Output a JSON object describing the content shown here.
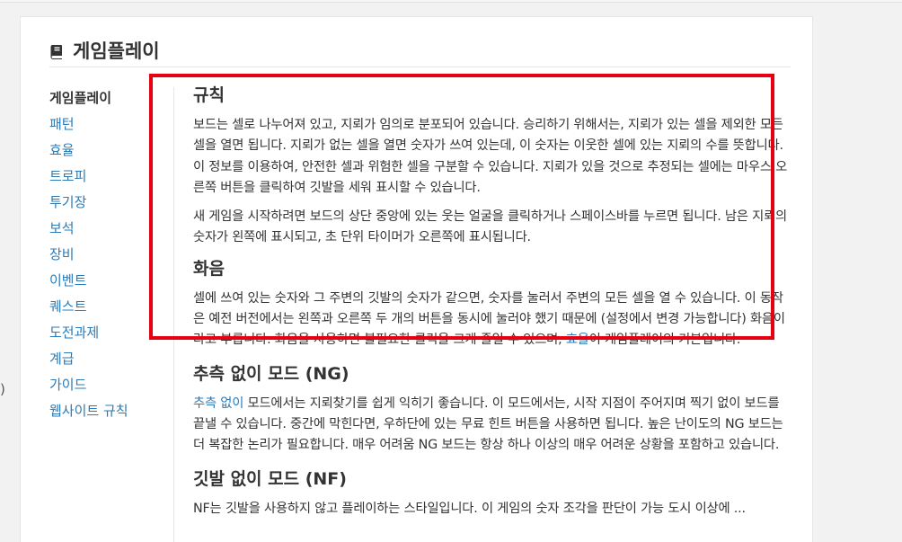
{
  "left_stub_text": ")",
  "page": {
    "title": "게임플레이",
    "icon": "book-icon"
  },
  "sidebar": {
    "items": [
      {
        "label": "게임플레이",
        "active": true
      },
      {
        "label": "패턴"
      },
      {
        "label": "효율"
      },
      {
        "label": "트로피"
      },
      {
        "label": "투기장"
      },
      {
        "label": "보석"
      },
      {
        "label": "장비"
      },
      {
        "label": "이벤트"
      },
      {
        "label": "퀘스트"
      },
      {
        "label": "도전과제"
      },
      {
        "label": "계급"
      },
      {
        "label": "가이드"
      },
      {
        "label": "웹사이트 규칙"
      }
    ]
  },
  "content": {
    "rules": {
      "heading": "규칙",
      "p1": "보드는 셀로 나누어져 있고, 지뢰가 임의로 분포되어 있습니다. 승리하기 위해서는, 지뢰가 있는 셀을 제외한 모든 셀을 열면 됩니다. 지뢰가 없는 셀을 열면 숫자가 쓰여 있는데, 이 숫자는 이웃한 셀에 있는 지뢰의 수를 뜻합니다. 이 정보를 이용하여, 안전한 셀과 위험한 셀을 구분할 수 있습니다. 지뢰가 있을 것으로 추정되는 셀에는 마우스 오른쪽 버튼을 클릭하여 깃발을 세워 표시할 수 있습니다.",
      "p2": "새 게임을 시작하려면 보드의 상단 중앙에 있는 웃는 얼굴을 클릭하거나 스페이스바를 누르면 됩니다. 남은 지뢰의 숫자가 왼쪽에 표시되고, 초 단위 타이머가 오른쪽에 표시됩니다."
    },
    "chord": {
      "heading": "화음",
      "text_before": "셀에 쓰여 있는 숫자와 그 주변의 깃발의 숫자가 같으면, 숫자를 눌러서 주변의 모든 셀을 열 수 있습니다. 이 동작은 예전 버전에서는 왼쪽과 오른쪽 두 개의 버튼을 동시에 눌러야 했기 때문에 (설정에서 변경 가능합니다) 화음이라고 부릅니다. 화음을 사용하면 불필요한 클릭을 크게 줄일 수 있으며, ",
      "link": "효율",
      "text_after": "이 게임플레이의 기본입니다."
    },
    "ng": {
      "heading": "추측 없이 모드 (NG)",
      "link": "추측 없이",
      "text": " 모드에서는 지뢰찾기를 쉽게 익히기 좋습니다. 이 모드에서는, 시작 지점이 주어지며 찍기 없이 보드를 끝낼 수 있습니다. 중간에 막힌다면, 우하단에 있는 무료 힌트 버튼을 사용하면 됩니다. 높은 난이도의 NG 보드는 더 복잡한 논리가 필요합니다. 매우 어려움 NG 보드는 항상 하나 이상의 매우 어려운 상황을 포함하고 있습니다."
    },
    "nf": {
      "heading": "깃발 없이 모드 (NF)",
      "text": "NF는 깃발을 사용하지 않고 플레이하는 스타일입니다. 이 게임의 숫자 조각을 판단이 가능 도시 이상에 ..."
    }
  },
  "colors": {
    "link": "#2a7bb8",
    "highlight_border": "#e60012",
    "text": "#333333"
  }
}
